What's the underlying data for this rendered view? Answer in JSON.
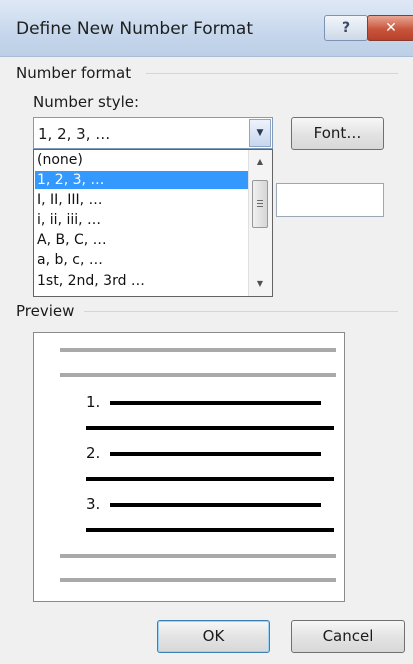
{
  "dialog": {
    "title": "Define New Number Format",
    "help_glyph": "?",
    "close_glyph": "✕"
  },
  "number_format": {
    "group_label": "Number format",
    "style_label": "Number style:",
    "style_value": "1, 2, 3, …",
    "font_button": "Font…",
    "options": [
      {
        "label": "(none)",
        "selected": false
      },
      {
        "label": "1, 2, 3, …",
        "selected": true
      },
      {
        "label": "I, II, III, …",
        "selected": false
      },
      {
        "label": "i, ii, iii, …",
        "selected": false
      },
      {
        "label": "A, B, C, …",
        "selected": false
      },
      {
        "label": "a, b, c, …",
        "selected": false
      },
      {
        "label": "1st, 2nd, 3rd …",
        "selected": false
      }
    ]
  },
  "preview": {
    "label": "Preview",
    "items": [
      "1.",
      "2.",
      "3."
    ]
  },
  "buttons": {
    "ok": "OK",
    "cancel": "Cancel"
  },
  "colors": {
    "selection": "#3399ff",
    "close_button": "#c8553c",
    "dialog_background": "#f0f0f0"
  }
}
